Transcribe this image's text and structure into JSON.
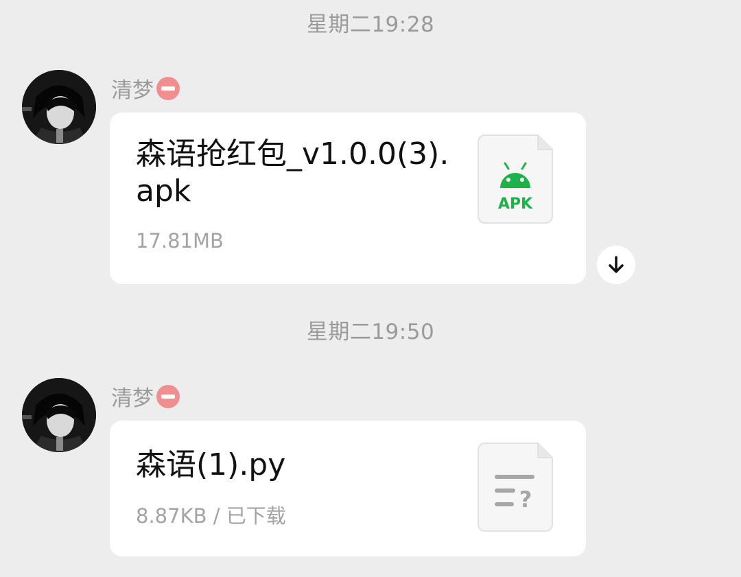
{
  "messages": [
    {
      "timestamp": "星期二19:28",
      "sender": "清梦",
      "file": {
        "name": "森语抢红包_v1.0.0(3).apk",
        "meta": "17.81MB",
        "icon": "apk-file-icon",
        "icon_label": "APK",
        "icon_color": "#1fb14a"
      },
      "download_icon": "download-arrow-icon"
    },
    {
      "timestamp": "星期二19:50",
      "sender": "清梦",
      "file": {
        "name": "森语(1).py",
        "meta": "8.87KB / 已下载",
        "icon": "unknown-file-icon"
      }
    }
  ]
}
